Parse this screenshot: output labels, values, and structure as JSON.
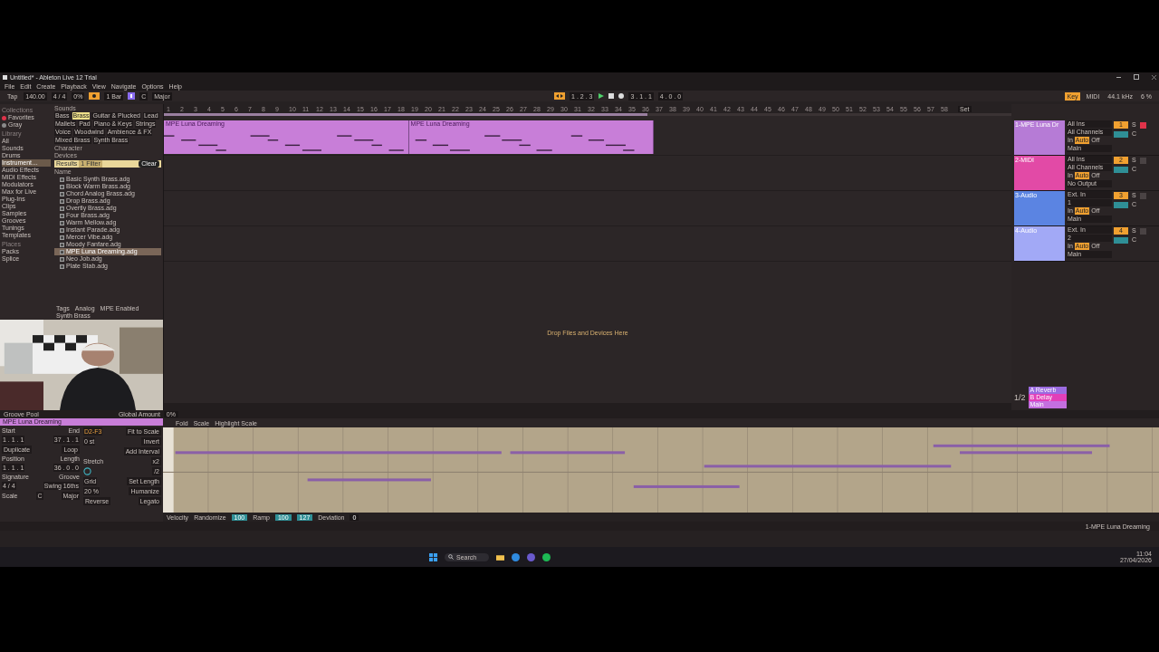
{
  "window": {
    "title": "Untitled* - Ableton Live 12 Trial"
  },
  "menu": [
    "File",
    "Edit",
    "Create",
    "Playback",
    "View",
    "Navigate",
    "Options",
    "Help"
  ],
  "control_bar": {
    "tap": "Tap",
    "tempo": "140.00",
    "time_signature": "4 / 4",
    "swing": "0%",
    "quantize": "1 Bar",
    "key": "C",
    "scale": "Major"
  },
  "transport": {
    "position": "1 . 2 . 3",
    "loop_start": "3 . 1 . 1",
    "loop_length": "4 . 0 . 0"
  },
  "status_right": {
    "key": "Key",
    "midi": "MIDI",
    "sample_rate": "44.1 kHz",
    "cpu": "6 %"
  },
  "browser": {
    "collections_title": "Collections",
    "collections": [
      {
        "label": "Favorites",
        "color": "#e0334a"
      },
      {
        "label": "Gray",
        "color": "#8a8a8a"
      }
    ],
    "library_title": "Library",
    "library": [
      {
        "label": "All",
        "selected": false
      },
      {
        "label": "Sounds",
        "selected": false
      },
      {
        "label": "Drums",
        "selected": false
      },
      {
        "label": "Instrument…",
        "selected": true
      },
      {
        "label": "Audio Effects",
        "selected": false
      },
      {
        "label": "MIDI Effects",
        "selected": false
      },
      {
        "label": "Modulators",
        "selected": false
      },
      {
        "label": "Max for Live",
        "selected": false
      },
      {
        "label": "Plug-Ins",
        "selected": false
      },
      {
        "label": "Clips",
        "selected": false
      },
      {
        "label": "Samples",
        "selected": false
      },
      {
        "label": "Grooves",
        "selected": false
      },
      {
        "label": "Tunings",
        "selected": false
      },
      {
        "label": "Templates",
        "selected": false
      }
    ],
    "places_title": "Places",
    "places": [
      "Packs",
      "Splice"
    ],
    "filter_title": "Sounds",
    "tags": [
      {
        "label": "Bass",
        "selected": false
      },
      {
        "label": "Brass",
        "selected": true
      },
      {
        "label": "Guitar & Plucked",
        "selected": false
      },
      {
        "label": "Lead",
        "selected": false
      },
      {
        "label": "Mallets",
        "selected": false
      },
      {
        "label": "Pad",
        "selected": false
      },
      {
        "label": "Piano & Keys",
        "selected": false
      },
      {
        "label": "Strings",
        "selected": false
      },
      {
        "label": "Voice",
        "selected": false
      },
      {
        "label": "Woodwind",
        "selected": false
      },
      {
        "label": "Ambience & FX",
        "selected": false
      }
    ],
    "subtags": [
      "Mixed Brass",
      "Synth Brass"
    ],
    "sections": [
      "Character",
      "Devices"
    ],
    "results_label": "Results",
    "filter_count": "1 Filter",
    "clear": "Clear",
    "name_header": "Name",
    "files": [
      {
        "label": "Basic Synth Brass.adg",
        "selected": false
      },
      {
        "label": "Block Warm Brass.adg",
        "selected": false
      },
      {
        "label": "Chord Analog Brass.adg",
        "selected": false
      },
      {
        "label": "Drop Brass.adg",
        "selected": false
      },
      {
        "label": "Overtly Brass.adg",
        "selected": false
      },
      {
        "label": "Four Brass.adg",
        "selected": false
      },
      {
        "label": "Warm Mellow.adg",
        "selected": false
      },
      {
        "label": "Instant Parade.adg",
        "selected": false
      },
      {
        "label": "Mercer Vibe.adg",
        "selected": false
      },
      {
        "label": "Moody Fanfare.adg",
        "selected": false
      },
      {
        "label": "MPE Luna Dreaming.adg",
        "selected": true
      },
      {
        "label": "Neo Job.adg",
        "selected": false
      },
      {
        "label": "Plate Stab.adg",
        "selected": false
      }
    ],
    "footer_tags": [
      "Tags",
      "Analog",
      "MPE Enabled",
      "Synth Brass"
    ]
  },
  "arrangement": {
    "ruler": [
      "1",
      "2",
      "3",
      "4",
      "5",
      "6",
      "7",
      "8",
      "9",
      "10",
      "11",
      "12",
      "13",
      "14",
      "15",
      "16",
      "17",
      "18",
      "19",
      "20",
      "21",
      "22",
      "23",
      "24",
      "25",
      "26",
      "27",
      "28",
      "29",
      "30",
      "31",
      "32",
      "33",
      "34",
      "35",
      "36",
      "37",
      "38",
      "39",
      "40",
      "41",
      "42",
      "43",
      "44",
      "45",
      "46",
      "47",
      "48",
      "49",
      "50",
      "51",
      "52",
      "53",
      "54",
      "55",
      "56",
      "57",
      "58"
    ],
    "set_button": "Set",
    "clips": [
      {
        "name": "MPE Luna Dreaming",
        "color": "#c87ed8"
      },
      {
        "name": "MPE Luna Dreaming",
        "color": "#c87ed8"
      }
    ],
    "drop_hint": "Drop Files and Devices Here"
  },
  "mixer": {
    "tracks": [
      {
        "name": "1-MPE Luna Dr",
        "color": "#b67bd6",
        "input": "All Ins",
        "channel": "All Channels",
        "monitor": [
          "In",
          "Auto",
          "Off"
        ],
        "output": "Main",
        "number": "1",
        "solo": "S",
        "cue": "C",
        "armed": true
      },
      {
        "name": "2-MIDI",
        "color": "#e24aa6",
        "input": "All Ins",
        "channel": "All Channels",
        "monitor": [
          "In",
          "Auto",
          "Off"
        ],
        "output": "No Output",
        "number": "2",
        "solo": "S",
        "cue": "C",
        "armed": false
      },
      {
        "name": "3-Audio",
        "color": "#5b84e2",
        "input": "Ext. In",
        "channel": "1",
        "monitor": [
          "In",
          "Auto",
          "Off"
        ],
        "output": "Main",
        "number": "3",
        "solo": "S",
        "cue": "C",
        "armed": false
      },
      {
        "name": "4-Audio",
        "color": "#a2a9f6",
        "input": "Ext. In",
        "channel": "2",
        "monitor": [
          "In",
          "Auto",
          "Off"
        ],
        "output": "Main",
        "number": "4",
        "solo": "S",
        "cue": "C",
        "armed": false
      }
    ],
    "returns": [
      {
        "name": "A Reverb",
        "color": "#9b6be0"
      },
      {
        "name": "B Delay",
        "color": "#e23fb9"
      },
      {
        "name": "Main",
        "color": "#c46fdf"
      }
    ],
    "page": "1/2"
  },
  "clip_view": {
    "groove_pool": "Groove Pool",
    "global_amount": "Global Amount",
    "global_value": "0%",
    "clip_name": "MPE Luna Dreaming",
    "start_label": "Start",
    "start": "1 . 1 . 1",
    "end_label": "End",
    "end": "37 . 1 . 1",
    "duplicate": "Duplicate",
    "loop": "Loop",
    "position_label": "Position",
    "position": "1 . 1 . 1",
    "length_label": "Length",
    "length": "36 . 0 . 0",
    "signature_label": "Signature",
    "signature": "4 / 4",
    "groove_label": "Groove",
    "groove": "Swing 16ths",
    "scale_label": "Scale",
    "scale_key": "C",
    "scale": "Major",
    "range": "D2-F3",
    "fit_to_scale": "Fit to Scale",
    "invert": "Invert",
    "transpose": "0 st",
    "add_interval": "Add Interval",
    "stretch": "Stretch",
    "double": "x2",
    "half": "/2",
    "grid": "Grid",
    "set_length": "Set Length",
    "amount": "20 %",
    "humanize": "Humanize",
    "reverse": "Reverse",
    "legato": "Legato",
    "roll_tabs": [
      "Fold",
      "Scale",
      "Highlight Scale"
    ],
    "velocity": {
      "label": "Velocity",
      "randomize": "Randomize",
      "randomize_value": "100",
      "ramp": "Ramp",
      "ramp_from": "100",
      "ramp_to": "127",
      "deviation": "Deviation",
      "deviation_value": "0"
    }
  },
  "status_bar": {
    "right": "1-MPE Luna Dreaming"
  },
  "taskbar": {
    "search": "Search",
    "time": "11:04",
    "date": "27/04/2026"
  }
}
